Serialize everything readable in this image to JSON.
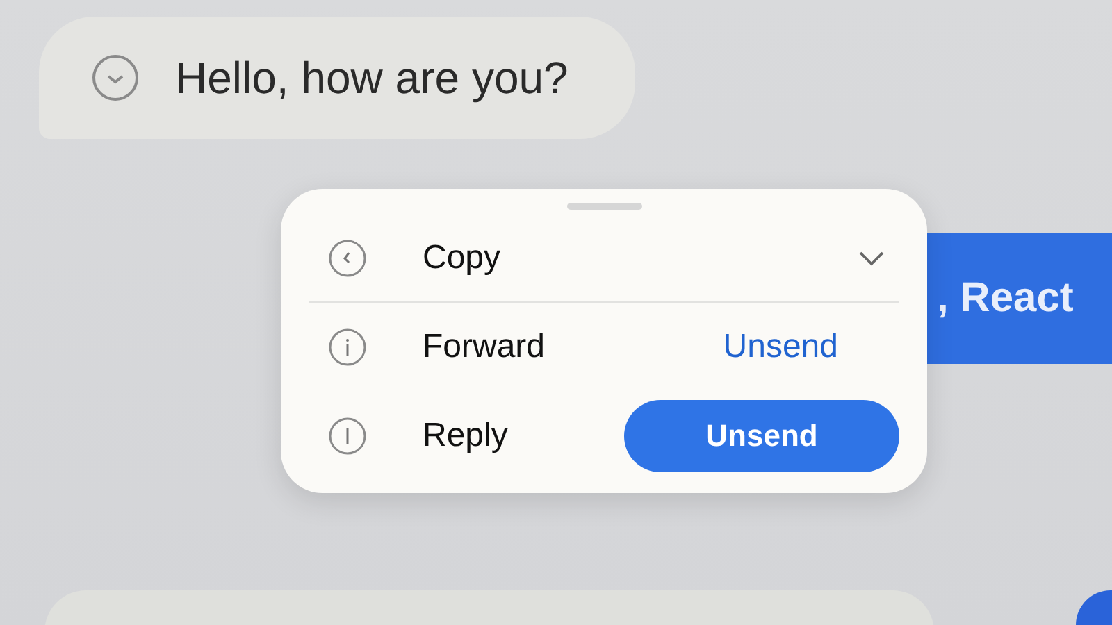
{
  "chat": {
    "incoming": {
      "text": "Hello, how are you?"
    },
    "outgoing": {
      "text": ", React"
    }
  },
  "menu": {
    "items": [
      {
        "label": "Copy",
        "kind": "expand"
      },
      {
        "label": "Forward",
        "kind": "link",
        "action": "Unsend"
      },
      {
        "label": "Reply",
        "kind": "button",
        "action": "Unsend"
      }
    ]
  }
}
